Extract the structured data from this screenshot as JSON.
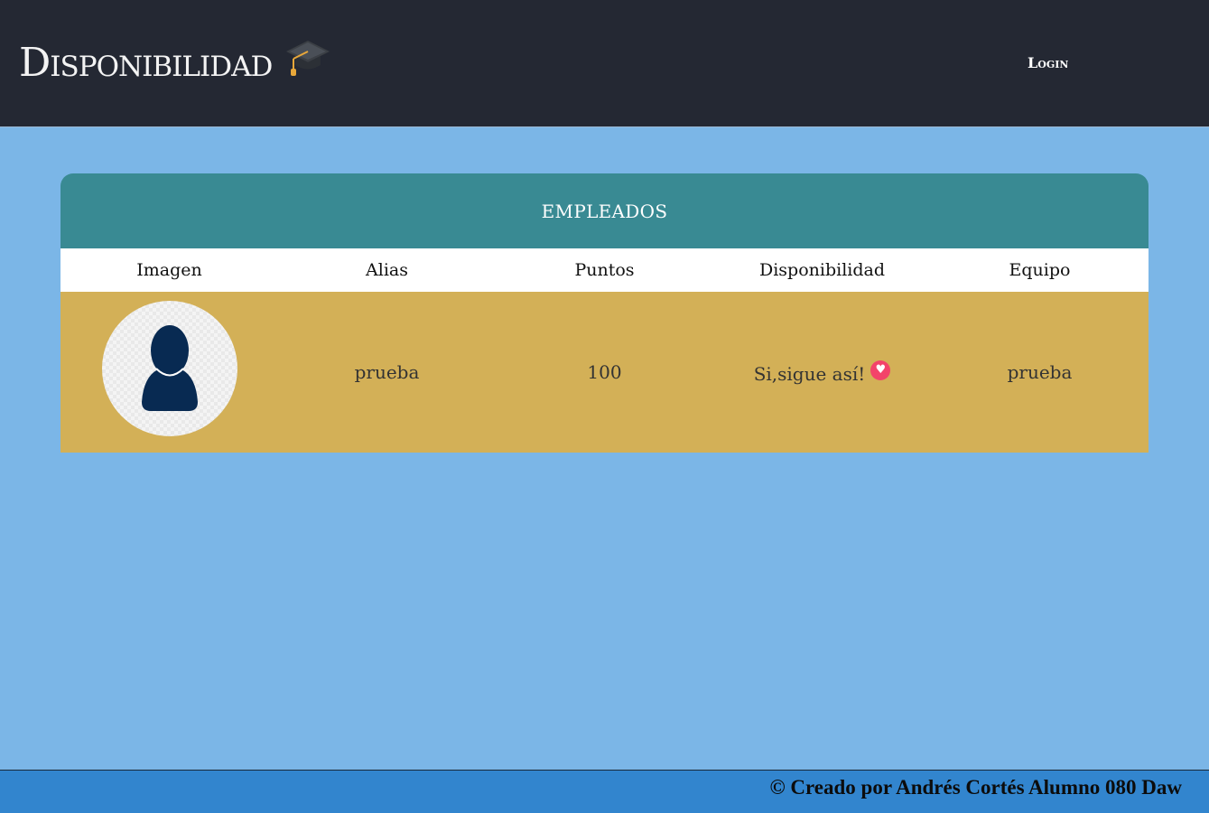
{
  "navbar": {
    "brand_title": "Disponibilidad",
    "brand_icon": "graduation-cap-icon",
    "login_label": "Login"
  },
  "panel": {
    "title": "EMPLEADOS",
    "columns": [
      "Imagen",
      "Alias",
      "Puntos",
      "Disponibilidad",
      "Equipo"
    ],
    "rows": [
      {
        "avatar_icon": "user-avatar-icon",
        "alias": "prueba",
        "puntos": "100",
        "disponibilidad": "Si,sigue así!",
        "disponibilidad_icon": "heart-icon",
        "equipo": "prueba"
      }
    ]
  },
  "footer": {
    "text": "© Creado por Andrés Cortés Alumno 080 Daw"
  },
  "colors": {
    "navbar_bg": "#242833",
    "page_bg": "#7bb6e7",
    "panel_header_bg": "#398a93",
    "row_bg": "#d3b057",
    "footer_bg": "#3285ce",
    "heart": "#f3436a"
  }
}
